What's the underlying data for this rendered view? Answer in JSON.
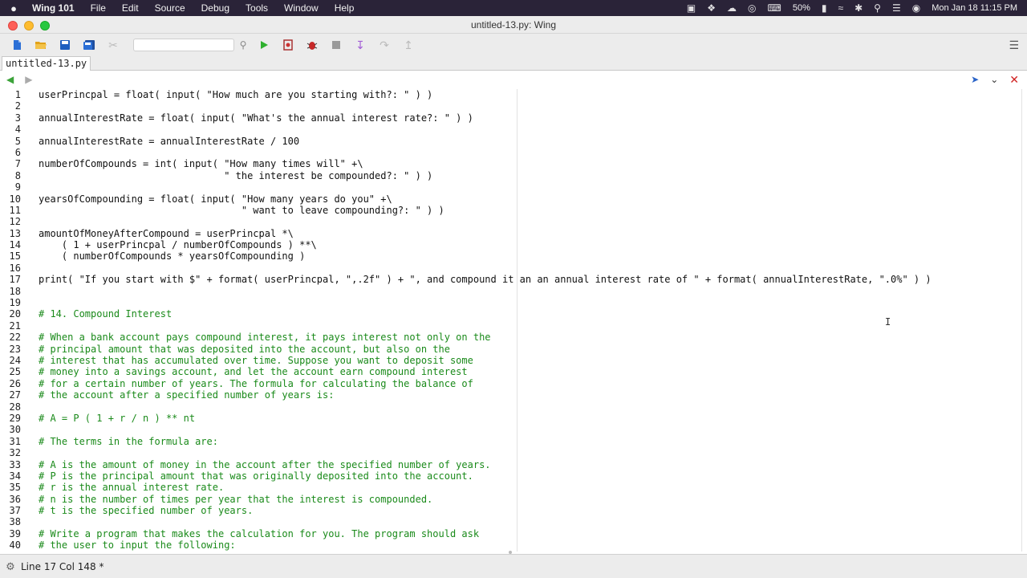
{
  "menubar": {
    "app_name": "Wing 101",
    "items": [
      "File",
      "Edit",
      "Source",
      "Debug",
      "Tools",
      "Window",
      "Help"
    ],
    "battery": "50%",
    "datetime": "Mon Jan 18  11:15 PM"
  },
  "window": {
    "title": "untitled-13.py: Wing"
  },
  "toolbar": {
    "search_value": "",
    "search_placeholder": ""
  },
  "editor_tab": {
    "label": "untitled-13.py"
  },
  "code_lines": [
    {
      "n": "1",
      "text": "userPrincpal = float( input( \"How much are you starting with?: \" ) )",
      "type": "code"
    },
    {
      "n": "2",
      "text": "",
      "type": "code"
    },
    {
      "n": "3",
      "text": "annualInterestRate = float( input( \"What's the annual interest rate?: \" ) )",
      "type": "code"
    },
    {
      "n": "4",
      "text": "",
      "type": "code"
    },
    {
      "n": "5",
      "text": "annualInterestRate = annualInterestRate / 100",
      "type": "code"
    },
    {
      "n": "6",
      "text": "",
      "type": "code"
    },
    {
      "n": "7",
      "text": "numberOfCompounds = int( input( \"How many times will\" +\\",
      "type": "code"
    },
    {
      "n": "8",
      "text": "                                \" the interest be compounded?: \" ) )",
      "type": "code"
    },
    {
      "n": "9",
      "text": "",
      "type": "code"
    },
    {
      "n": "10",
      "text": "yearsOfCompounding = float( input( \"How many years do you\" +\\",
      "type": "code"
    },
    {
      "n": "11",
      "text": "                                   \" want to leave compounding?: \" ) )",
      "type": "code"
    },
    {
      "n": "12",
      "text": "",
      "type": "code"
    },
    {
      "n": "13",
      "text": "amountOfMoneyAfterCompound = userPrincpal *\\",
      "type": "code"
    },
    {
      "n": "14",
      "text": "    ( 1 + userPrincpal / numberOfCompounds ) **\\",
      "type": "code"
    },
    {
      "n": "15",
      "text": "    ( numberOfCompounds * yearsOfCompounding )",
      "type": "code"
    },
    {
      "n": "16",
      "text": "",
      "type": "code"
    },
    {
      "n": "17",
      "text": "print( \"If you start with $\" + format( userPrincpal, \",.2f\" ) + \", and compound it an an annual interest rate of \" + format( annualInterestRate, \".0%\" ) )",
      "type": "code"
    },
    {
      "n": "18",
      "text": "",
      "type": "code"
    },
    {
      "n": "19",
      "text": "",
      "type": "code"
    },
    {
      "n": "20",
      "text": "# 14. Compound Interest",
      "type": "comment"
    },
    {
      "n": "21",
      "text": "",
      "type": "comment"
    },
    {
      "n": "22",
      "text": "# When a bank account pays compound interest, it pays interest not only on the",
      "type": "comment"
    },
    {
      "n": "23",
      "text": "# principal amount that was deposited into the account, but also on the",
      "type": "comment"
    },
    {
      "n": "24",
      "text": "# interest that has accumulated over time. Suppose you want to deposit some",
      "type": "comment"
    },
    {
      "n": "25",
      "text": "# money into a savings account, and let the account earn compound interest",
      "type": "comment"
    },
    {
      "n": "26",
      "text": "# for a certain number of years. The formula for calculating the balance of",
      "type": "comment"
    },
    {
      "n": "27",
      "text": "# the account after a specified number of years is:",
      "type": "comment"
    },
    {
      "n": "28",
      "text": "",
      "type": "comment"
    },
    {
      "n": "29",
      "text": "# A = P ( 1 + r / n ) ** nt",
      "type": "comment"
    },
    {
      "n": "30",
      "text": "",
      "type": "comment"
    },
    {
      "n": "31",
      "text": "# The terms in the formula are:",
      "type": "comment"
    },
    {
      "n": "32",
      "text": "",
      "type": "comment"
    },
    {
      "n": "33",
      "text": "# A is the amount of money in the account after the specified number of years.",
      "type": "comment"
    },
    {
      "n": "34",
      "text": "# P is the principal amount that was originally deposited into the account.",
      "type": "comment"
    },
    {
      "n": "35",
      "text": "# r is the annual interest rate.",
      "type": "comment"
    },
    {
      "n": "36",
      "text": "# n is the number of times per year that the interest is compounded.",
      "type": "comment"
    },
    {
      "n": "37",
      "text": "# t is the specified number of years.",
      "type": "comment"
    },
    {
      "n": "38",
      "text": "",
      "type": "comment"
    },
    {
      "n": "39",
      "text": "# Write a program that makes the calculation for you. The program should ask",
      "type": "comment"
    },
    {
      "n": "40",
      "text": "# the user to input the following:",
      "type": "comment"
    }
  ],
  "statusbar": {
    "position": "Line 17 Col 148 *"
  },
  "icons": {
    "apple": "apple-icon",
    "new_file": "new-file-icon",
    "open": "open-folder-icon",
    "save": "save-icon",
    "save_all": "save-all-icon",
    "run": "run-icon",
    "debug": "bug-icon"
  },
  "colors": {
    "comment": "#1a8a1a",
    "run": "#2fb02f",
    "close": "#d02020"
  }
}
